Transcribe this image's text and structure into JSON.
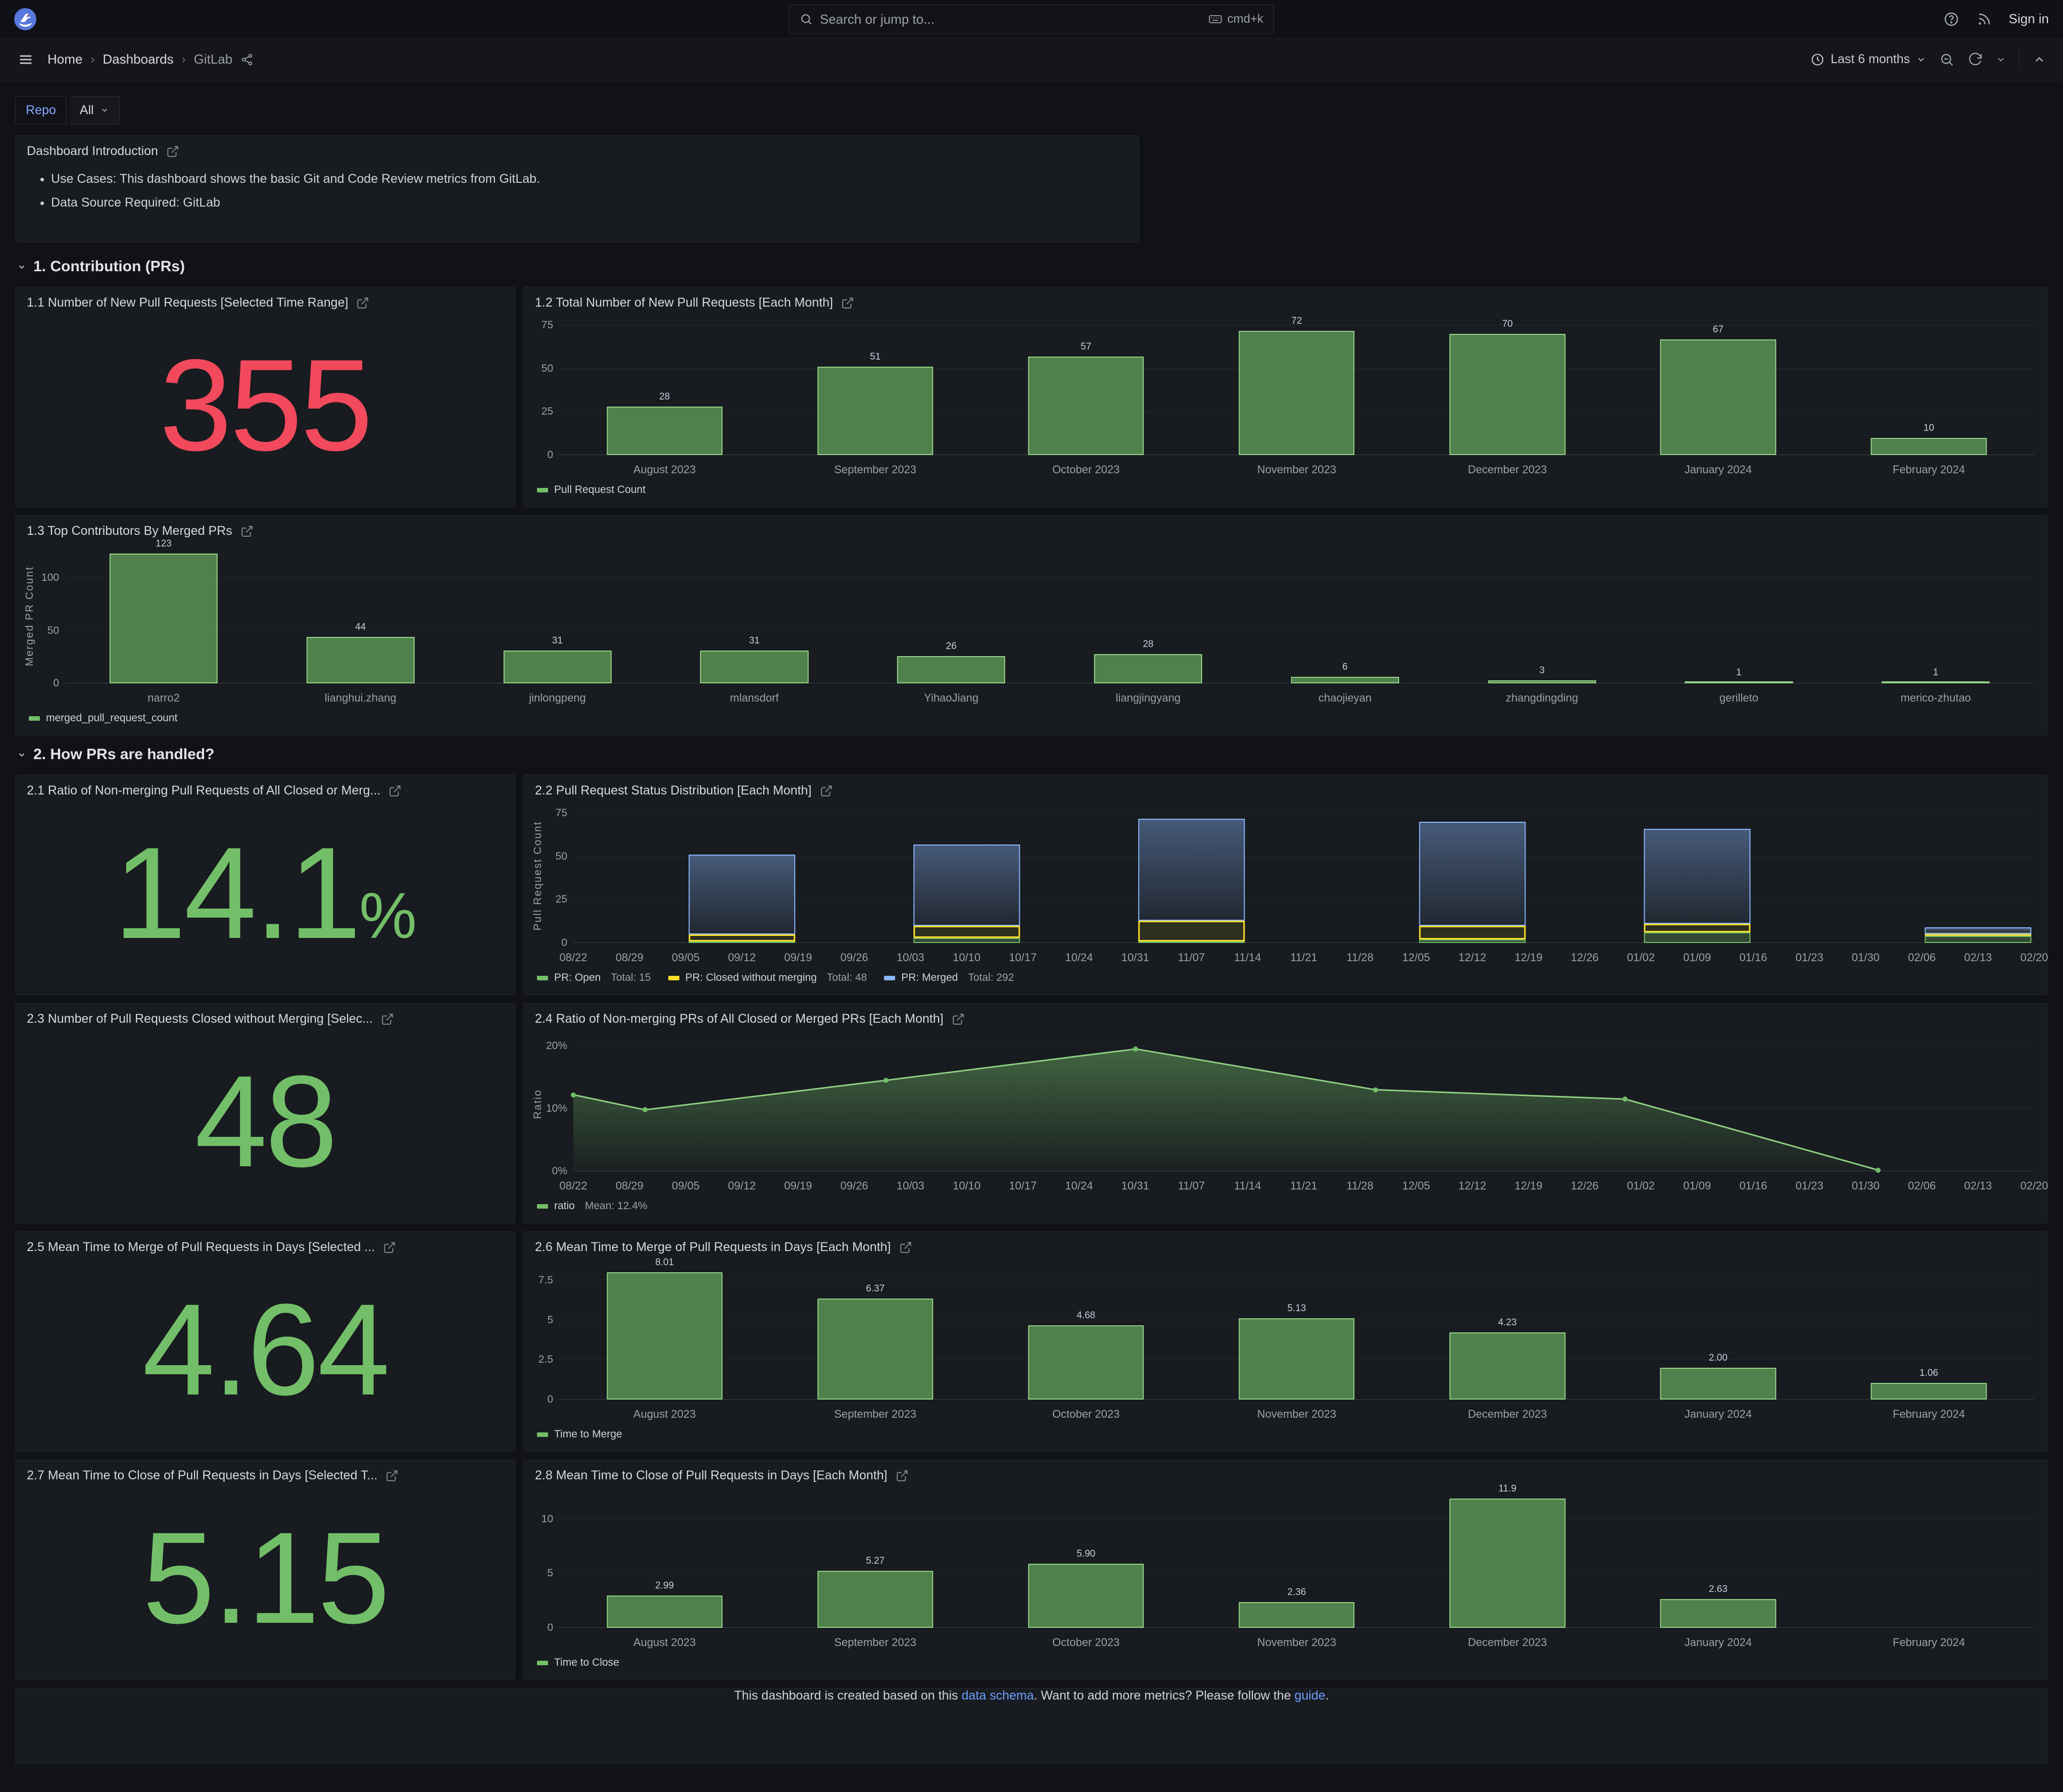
{
  "nav": {
    "search_placeholder": "Search or jump to...",
    "shortcut": "cmd+k",
    "sign_in": "Sign in"
  },
  "breadcrumb": {
    "items": [
      "Home",
      "Dashboards",
      "GitLab"
    ]
  },
  "toolbar": {
    "time_range": "Last 6 months"
  },
  "variables": {
    "label": "Repo",
    "value": "All"
  },
  "intro": {
    "title": "Dashboard Introduction",
    "bullets": [
      "Use Cases: This dashboard shows the basic Git and Code Review metrics from GitLab.",
      "Data Source Required: GitLab"
    ]
  },
  "sections": {
    "s1": "1. Contribution (PRs)",
    "s2": "2. How PRs are handled?"
  },
  "panels": {
    "p11": {
      "title": "1.1 Number of New Pull Requests [Selected Time Range]",
      "value": "355",
      "color": "#F2495C"
    },
    "p12": {
      "title": "1.2 Total Number of New Pull Requests [Each Month]"
    },
    "p13": {
      "title": "1.3 Top Contributors By Merged PRs"
    },
    "p21": {
      "title": "2.1 Ratio of Non-merging Pull Requests of All Closed or Merg...",
      "value": "14.1",
      "suffix": "%",
      "color": "#73BF69"
    },
    "p22": {
      "title": "2.2 Pull Request Status Distribution [Each Month]"
    },
    "p23": {
      "title": "2.3 Number of Pull Requests Closed without Merging [Selec...",
      "value": "48",
      "color": "#73BF69"
    },
    "p24": {
      "title": "2.4 Ratio of Non-merging PRs of All Closed or Merged PRs [Each Month]"
    },
    "p25": {
      "title": "2.5 Mean Time to Merge of Pull Requests in Days [Selected ...",
      "value": "4.64",
      "color": "#73BF69"
    },
    "p26": {
      "title": "2.6 Mean Time to Merge of Pull Requests in Days [Each Month]"
    },
    "p27": {
      "title": "2.7 Mean Time to Close of Pull Requests in Days [Selected T...",
      "value": "5.15",
      "color": "#73BF69"
    },
    "p28": {
      "title": "2.8 Mean Time to Close of Pull Requests in Days [Each Month]"
    }
  },
  "footer": {
    "text_before": "This dashboard is created based on this ",
    "link1": "data schema",
    "text_mid": ". Want to add more metrics? Please follow the ",
    "link2": "guide",
    "text_after": "."
  },
  "colors": {
    "accent_blue": "#6E9FFF",
    "stat_red": "#F2495C",
    "green": "#73BF69",
    "yellow": "#FADE2A",
    "blue": "#8AB8FF",
    "panel_bg": "#181b1f",
    "canvas_bg": "#111217"
  },
  "chart_data": [
    {
      "id": "c12",
      "type": "bar",
      "title": "1.2 Total Number of New Pull Requests [Each Month]",
      "categories": [
        "August 2023",
        "September 2023",
        "October 2023",
        "November 2023",
        "December 2023",
        "January 2024",
        "February 2024"
      ],
      "values": [
        28,
        51,
        57,
        72,
        70,
        67,
        10
      ],
      "value_labels": [
        "28",
        "51",
        "57",
        "72",
        "70",
        "67",
        "10"
      ],
      "yticks": [
        {
          "v": 0,
          "label": "0"
        },
        {
          "v": 25,
          "label": "25"
        },
        {
          "v": 50,
          "label": "50"
        },
        {
          "v": 75,
          "label": "75"
        }
      ],
      "ymax": 78,
      "grid": true,
      "legend_position": "bottom",
      "legend": [
        {
          "label": "Pull Request Count",
          "color": "#73BF69"
        }
      ]
    },
    {
      "id": "c13",
      "type": "bar",
      "title": "1.3 Top Contributors By Merged PRs",
      "categories": [
        "narro2",
        "lianghui.zhang",
        "jinlongpeng",
        "mlansdorf",
        "YihaoJiang",
        "liangjingyang",
        "chaojieyan",
        "zhangdingding",
        "gerilleto",
        "merico-zhutao"
      ],
      "values": [
        123,
        44,
        31,
        31,
        26,
        28,
        6,
        3,
        1,
        1
      ],
      "value_labels": [
        "123",
        "44",
        "31",
        "31",
        "26",
        "28",
        "6",
        "3",
        "1",
        "1"
      ],
      "yticks": [
        {
          "v": 0,
          "label": "0"
        },
        {
          "v": 50,
          "label": "50"
        },
        {
          "v": 100,
          "label": "100"
        }
      ],
      "ymax": 128,
      "ylabel": "Merged PR Count",
      "grid": true,
      "legend_position": "bottom",
      "legend": [
        {
          "label": "merged_pull_request_count",
          "color": "#73BF69"
        }
      ]
    },
    {
      "id": "c22",
      "type": "stacked_bar",
      "title": "2.2 Pull Request Status Distribution [Each Month]",
      "x_ticks": [
        "08/22",
        "08/29",
        "09/05",
        "09/12",
        "09/19",
        "09/26",
        "10/03",
        "10/10",
        "10/17",
        "10/24",
        "10/31",
        "11/07",
        "11/14",
        "11/21",
        "11/28",
        "12/05",
        "12/12",
        "12/19",
        "12/26",
        "01/02",
        "01/09",
        "01/16",
        "01/23",
        "01/30",
        "02/06",
        "02/13",
        "02/20"
      ],
      "yticks": [
        {
          "v": 0,
          "label": "0"
        },
        {
          "v": 25,
          "label": "25"
        },
        {
          "v": 50,
          "label": "50"
        },
        {
          "v": 75,
          "label": "75"
        }
      ],
      "ymax": 78,
      "ylabel": "Pull Request Count",
      "grid": true,
      "legend_position": "bottom",
      "series": [
        {
          "name": "PR: Open",
          "total": 15,
          "color": "#73BF69"
        },
        {
          "name": "PR: Closed without merging",
          "total": 48,
          "color": "#FADE2A"
        },
        {
          "name": "PR: Merged",
          "total": 292,
          "color": "#8AB8FF"
        }
      ],
      "bars": [
        {
          "month": "September 2023",
          "center_tick": 3,
          "width_ticks": 2,
          "open": 1,
          "closed": 4,
          "merged": 46
        },
        {
          "month": "October 2023",
          "center_tick": 7,
          "width_ticks": 2,
          "open": 3,
          "closed": 7,
          "merged": 47
        },
        {
          "month": "November 2023",
          "center_tick": 11,
          "width_ticks": 2,
          "open": 1,
          "closed": 12,
          "merged": 59
        },
        {
          "month": "December 2023",
          "center_tick": 16,
          "width_ticks": 2,
          "open": 2,
          "closed": 8,
          "merged": 60
        },
        {
          "month": "January 2024",
          "center_tick": 20,
          "width_ticks": 2,
          "open": 6,
          "closed": 5,
          "merged": 55
        },
        {
          "month": "February 2024",
          "center_tick": 25,
          "width_ticks": 2,
          "open": 4,
          "closed": 1,
          "merged": 4
        }
      ],
      "legend": [
        {
          "label": "PR: Open",
          "extra": "Total: 15",
          "color": "#73BF69"
        },
        {
          "label": "PR: Closed without merging",
          "extra": "Total: 48",
          "color": "#FADE2A"
        },
        {
          "label": "PR: Merged",
          "extra": "Total: 292",
          "color": "#8AB8FF"
        }
      ]
    },
    {
      "id": "c24",
      "type": "line",
      "title": "2.4 Ratio of Non-merging PRs of All Closed or Merged PRs [Each Month]",
      "x_ticks": [
        "08/22",
        "08/29",
        "09/05",
        "09/12",
        "09/19",
        "09/26",
        "10/03",
        "10/10",
        "10/17",
        "10/24",
        "10/31",
        "11/07",
        "11/14",
        "11/21",
        "11/28",
        "12/05",
        "12/12",
        "12/19",
        "12/26",
        "01/02",
        "01/09",
        "01/16",
        "01/23",
        "01/30",
        "02/06",
        "02/13",
        "02/20"
      ],
      "yticks": [
        {
          "v": 0,
          "label": "0%"
        },
        {
          "v": 10,
          "label": "10%"
        },
        {
          "v": 20,
          "label": "20%"
        }
      ],
      "ymax": 21.5,
      "ylabel": "Ratio",
      "grid": true,
      "legend_position": "bottom",
      "points": [
        {
          "x": 0.0,
          "y": 12.2
        },
        {
          "x": 0.049,
          "y": 9.8
        },
        {
          "x": 0.214,
          "y": 14.5
        },
        {
          "x": 0.385,
          "y": 19.5
        },
        {
          "x": 0.549,
          "y": 13.0
        },
        {
          "x": 0.72,
          "y": 11.5
        },
        {
          "x": 0.893,
          "y": 0.2
        }
      ],
      "line_color": "#8fd083",
      "fill_color": "#73BF69",
      "legend": [
        {
          "label": "ratio",
          "extra": "Mean: 12.4%",
          "color": "#73BF69"
        }
      ]
    },
    {
      "id": "c26",
      "type": "bar",
      "title": "2.6 Mean Time to Merge of Pull Requests in Days [Each Month]",
      "categories": [
        "August 2023",
        "September 2023",
        "October 2023",
        "November 2023",
        "December 2023",
        "January 2024",
        "February 2024"
      ],
      "values": [
        8.01,
        6.37,
        4.68,
        5.13,
        4.23,
        2.0,
        1.06
      ],
      "value_labels": [
        "8.01",
        "6.37",
        "4.68",
        "5.13",
        "4.23",
        "2.00",
        "1.06"
      ],
      "yticks": [
        {
          "v": 0,
          "label": "0"
        },
        {
          "v": 2.5,
          "label": "2.5"
        },
        {
          "v": 5,
          "label": "5"
        },
        {
          "v": 7.5,
          "label": "7.5"
        }
      ],
      "ymax": 8.5,
      "grid": true,
      "legend_position": "bottom",
      "legend": [
        {
          "label": "Time to Merge",
          "color": "#73BF69"
        }
      ]
    },
    {
      "id": "c28",
      "type": "bar",
      "title": "2.8 Mean Time to Close of Pull Requests in Days [Each Month]",
      "categories": [
        "August 2023",
        "September 2023",
        "October 2023",
        "November 2023",
        "December 2023",
        "January 2024",
        "February 2024"
      ],
      "values": [
        2.99,
        5.27,
        5.9,
        2.36,
        11.9,
        2.63,
        null
      ],
      "value_labels": [
        "2.99",
        "5.27",
        "5.90",
        "2.36",
        "11.9",
        "2.63",
        ""
      ],
      "yticks": [
        {
          "v": 0,
          "label": "0"
        },
        {
          "v": 5,
          "label": "5"
        },
        {
          "v": 10,
          "label": "10"
        }
      ],
      "ymax": 12.4,
      "grid": true,
      "legend_position": "bottom",
      "legend": [
        {
          "label": "Time to Close",
          "color": "#73BF69"
        }
      ]
    }
  ]
}
